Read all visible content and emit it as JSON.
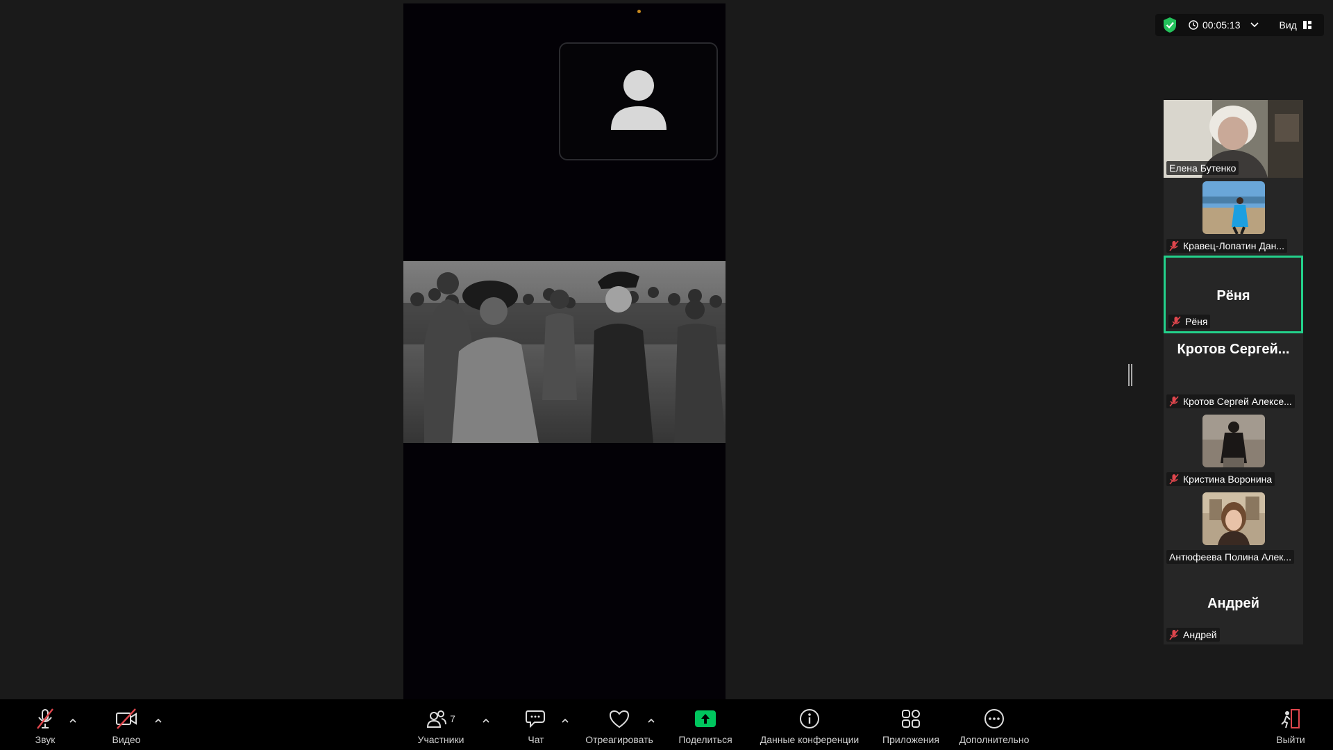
{
  "window": {
    "timer": "00:05:13",
    "view_label": "Вид"
  },
  "colors": {
    "accent_green": "#23d18b",
    "muted_red": "#e0464d",
    "share_green": "#00c65e"
  },
  "participants": [
    {
      "name": "Елена Бутенко",
      "muted": false,
      "display": "photo"
    },
    {
      "name": "Кравец-Лопатин Дан...",
      "muted": true,
      "display": "thumb"
    },
    {
      "name": "Рёня",
      "big_name": "Рёня",
      "muted": true,
      "display": "name",
      "active": true
    },
    {
      "name": "Кротов Сергей Алексе...",
      "big_name": "Кротов Сергей...",
      "muted": true,
      "display": "name"
    },
    {
      "name": "Кристина Воронина",
      "muted": true,
      "display": "thumb"
    },
    {
      "name": "Антюфеева Полина Алек...",
      "muted": false,
      "display": "thumb"
    },
    {
      "name": "Андрей",
      "big_name": "Андрей",
      "muted": true,
      "display": "name"
    }
  ],
  "toolbar": {
    "audio": "Звук",
    "video": "Видео",
    "participants": "Участники",
    "participants_count": "7",
    "chat": "Чат",
    "react": "Отреагировать",
    "share": "Поделиться",
    "meeting_info": "Данные конференции",
    "apps": "Приложения",
    "more": "Дополнительно",
    "leave": "Выйти"
  },
  "icons": {
    "security": "shield-check-icon",
    "timer": "clock-icon",
    "view": "grid-view-icon"
  }
}
